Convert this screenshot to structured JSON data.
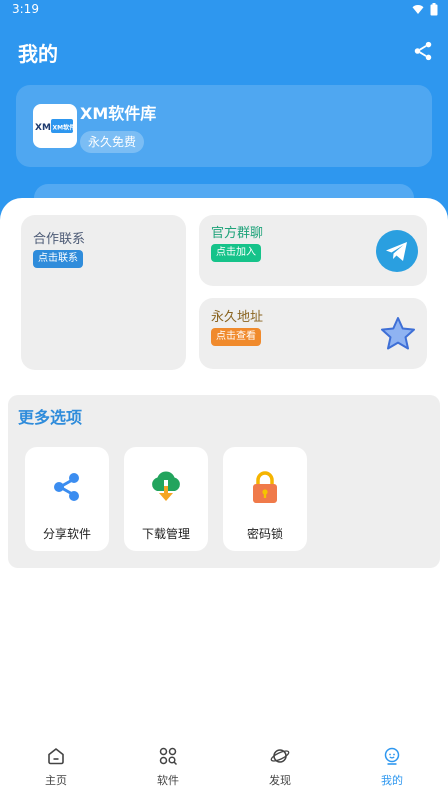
{
  "status_bar": {
    "time": "3:19"
  },
  "header": {
    "title": "我的"
  },
  "profile": {
    "name": "XM软件库",
    "tag": "永久免费",
    "logo_text": "XM软件库"
  },
  "cards": {
    "contact": {
      "title": "合作联系",
      "button": "点击联系"
    },
    "group": {
      "title": "官方群聊",
      "button": "点击加入"
    },
    "address": {
      "title": "永久地址",
      "button": "点击查看"
    }
  },
  "more": {
    "title": "更多选项",
    "items": [
      {
        "label": "分享软件",
        "icon": "share-icon"
      },
      {
        "label": "下载管理",
        "icon": "cloud-download-icon"
      },
      {
        "label": "密码锁",
        "icon": "padlock-icon"
      }
    ]
  },
  "tabbar": {
    "items": [
      {
        "label": "主页",
        "icon": "home-icon"
      },
      {
        "label": "软件",
        "icon": "apps-search-icon"
      },
      {
        "label": "发现",
        "icon": "planet-icon"
      },
      {
        "label": "我的",
        "icon": "profile-icon",
        "active": true
      }
    ]
  },
  "colors": {
    "primary": "#2e97ef",
    "pill_blue": "#2f8cdb",
    "pill_green": "#16c38a",
    "pill_orange": "#f08a2c",
    "telegram": "#2a9fe0"
  }
}
